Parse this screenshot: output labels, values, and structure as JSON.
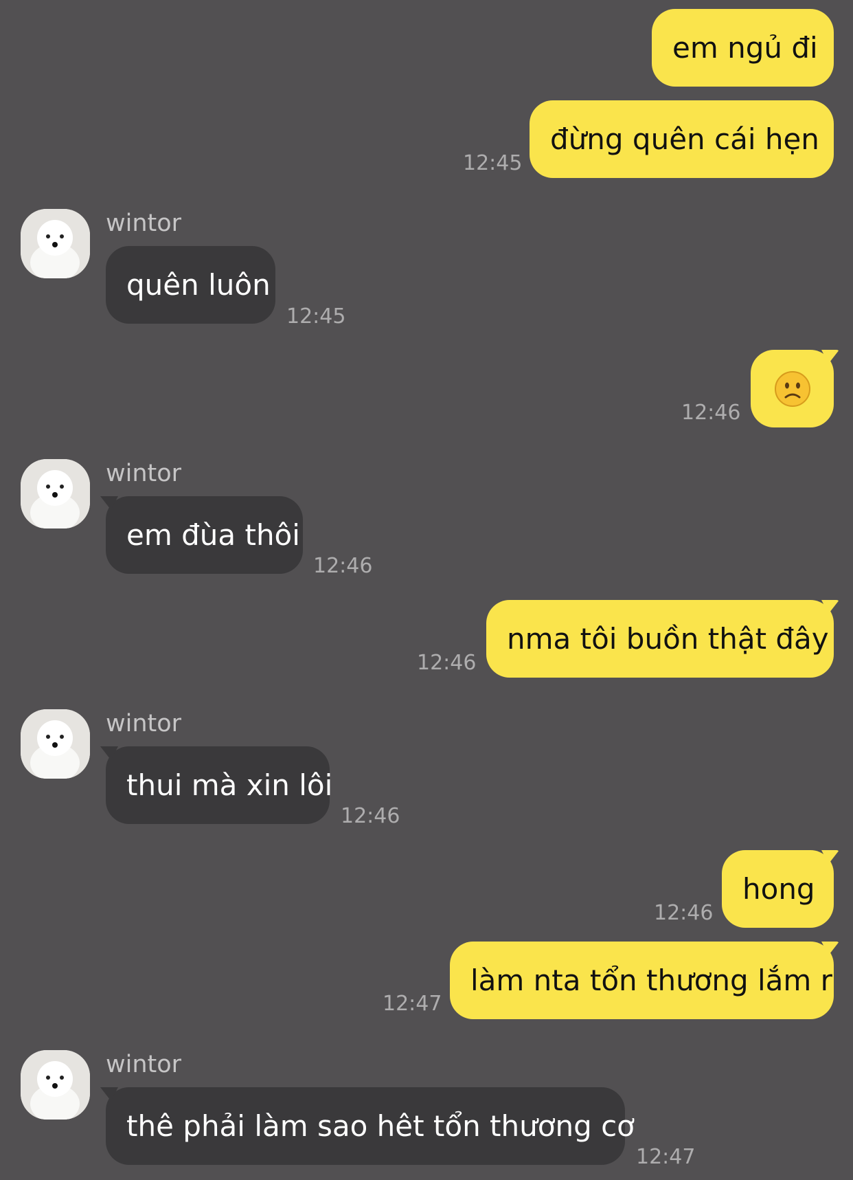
{
  "contact": {
    "name": "wintor"
  },
  "colors": {
    "background": "#525052",
    "my_bubble": "#fae44c",
    "their_bubble": "#3a393b"
  },
  "messages": [
    {
      "from": "me",
      "text": "em ngủ đi",
      "time": ""
    },
    {
      "from": "me",
      "text": "đừng quên cái hẹn",
      "time": "12:45"
    },
    {
      "from": "wintor",
      "text": "quên luôn",
      "time": "12:45"
    },
    {
      "from": "me",
      "emoji": "slightly-frowning-face-emoji",
      "time": "12:46"
    },
    {
      "from": "wintor",
      "text": "em đùa thôi",
      "time": "12:46"
    },
    {
      "from": "me",
      "text": "nma tôi buồn thật đây",
      "time": "12:46"
    },
    {
      "from": "wintor",
      "text": "thui mà xin lôi",
      "time": "12:46"
    },
    {
      "from": "me",
      "text": "hong",
      "time": "12:46"
    },
    {
      "from": "me",
      "text": "làm nta tổn thương lắm r",
      "time": "12:47"
    },
    {
      "from": "wintor",
      "text": "thê phải làm sao hêt tổn thương cơ",
      "time": "12:47"
    }
  ]
}
